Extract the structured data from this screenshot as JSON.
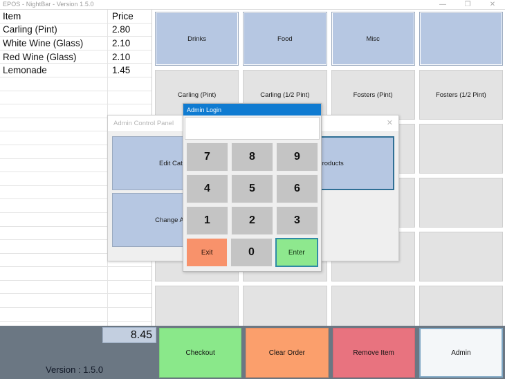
{
  "window": {
    "title": "EPOS - NightBar - Version 1.5.0",
    "minimize_icon": "—",
    "maximize_icon": "❐",
    "close_icon": "✕"
  },
  "order_list": {
    "header": {
      "item": "Item",
      "price": "Price"
    },
    "rows": [
      {
        "item": "Carling (Pint)",
        "price": "2.80"
      },
      {
        "item": "White Wine (Glass)",
        "price": "2.10"
      },
      {
        "item": "Red Wine (Glass)",
        "price": "2.10"
      },
      {
        "item": "Lemonade",
        "price": "1.45"
      }
    ],
    "empty_row_count": 19
  },
  "categories": [
    {
      "label": "Drinks"
    },
    {
      "label": "Food"
    },
    {
      "label": "Misc"
    },
    {
      "label": ""
    }
  ],
  "products": [
    {
      "label": "Carling (Pint)"
    },
    {
      "label": "Carling (1/2 Pint)"
    },
    {
      "label": "Fosters (Pint)"
    },
    {
      "label": "Fosters (1/2 Pint)"
    }
  ],
  "empty_product_rows": 4,
  "bottom": {
    "total": "8.45",
    "version": "Version : 1.5.0",
    "actions": [
      {
        "label": "Checkout",
        "style": "checkout",
        "color": "#8ae88a"
      },
      {
        "label": "Clear Order",
        "style": "clearorder",
        "color": "#fb9f6c"
      },
      {
        "label": "Remove Item",
        "style": "removeitem",
        "color": "#e8737f"
      },
      {
        "label": "Admin",
        "style": "admin",
        "color": "#f4f7f9"
      }
    ]
  },
  "admin_panel": {
    "title": "Admin Control Panel",
    "close_icon": "✕",
    "buttons_row1": [
      {
        "label": "Edit Categories",
        "focused": false
      },
      {
        "label": "Edit Products",
        "focused": true
      }
    ],
    "buttons_row2": [
      {
        "label": "Change Admin Pin",
        "focused": false
      },
      {
        "label": "",
        "focused": false
      }
    ]
  },
  "admin_login": {
    "title": "Admin Login",
    "input_value": "",
    "input_placeholder": "",
    "keys": [
      [
        {
          "label": "7",
          "type": "digit"
        },
        {
          "label": "8",
          "type": "digit"
        },
        {
          "label": "9",
          "type": "digit"
        }
      ],
      [
        {
          "label": "4",
          "type": "digit"
        },
        {
          "label": "5",
          "type": "digit"
        },
        {
          "label": "6",
          "type": "digit"
        }
      ],
      [
        {
          "label": "1",
          "type": "digit"
        },
        {
          "label": "2",
          "type": "digit"
        },
        {
          "label": "3",
          "type": "digit"
        }
      ],
      [
        {
          "label": "Exit",
          "type": "exit"
        },
        {
          "label": "0",
          "type": "digit"
        },
        {
          "label": "Enter",
          "type": "enter"
        }
      ]
    ],
    "colors": {
      "titlebar": "#0f7bd1",
      "exit": "#f8926b",
      "enter": "#8ee88e",
      "digit": "#c4c4c4"
    }
  },
  "colors": {
    "category_button": "#b6c7e2",
    "product_button": "#e3e3e3",
    "bottom_bar": "#6b7783",
    "total_box": "#c3cfe0"
  }
}
